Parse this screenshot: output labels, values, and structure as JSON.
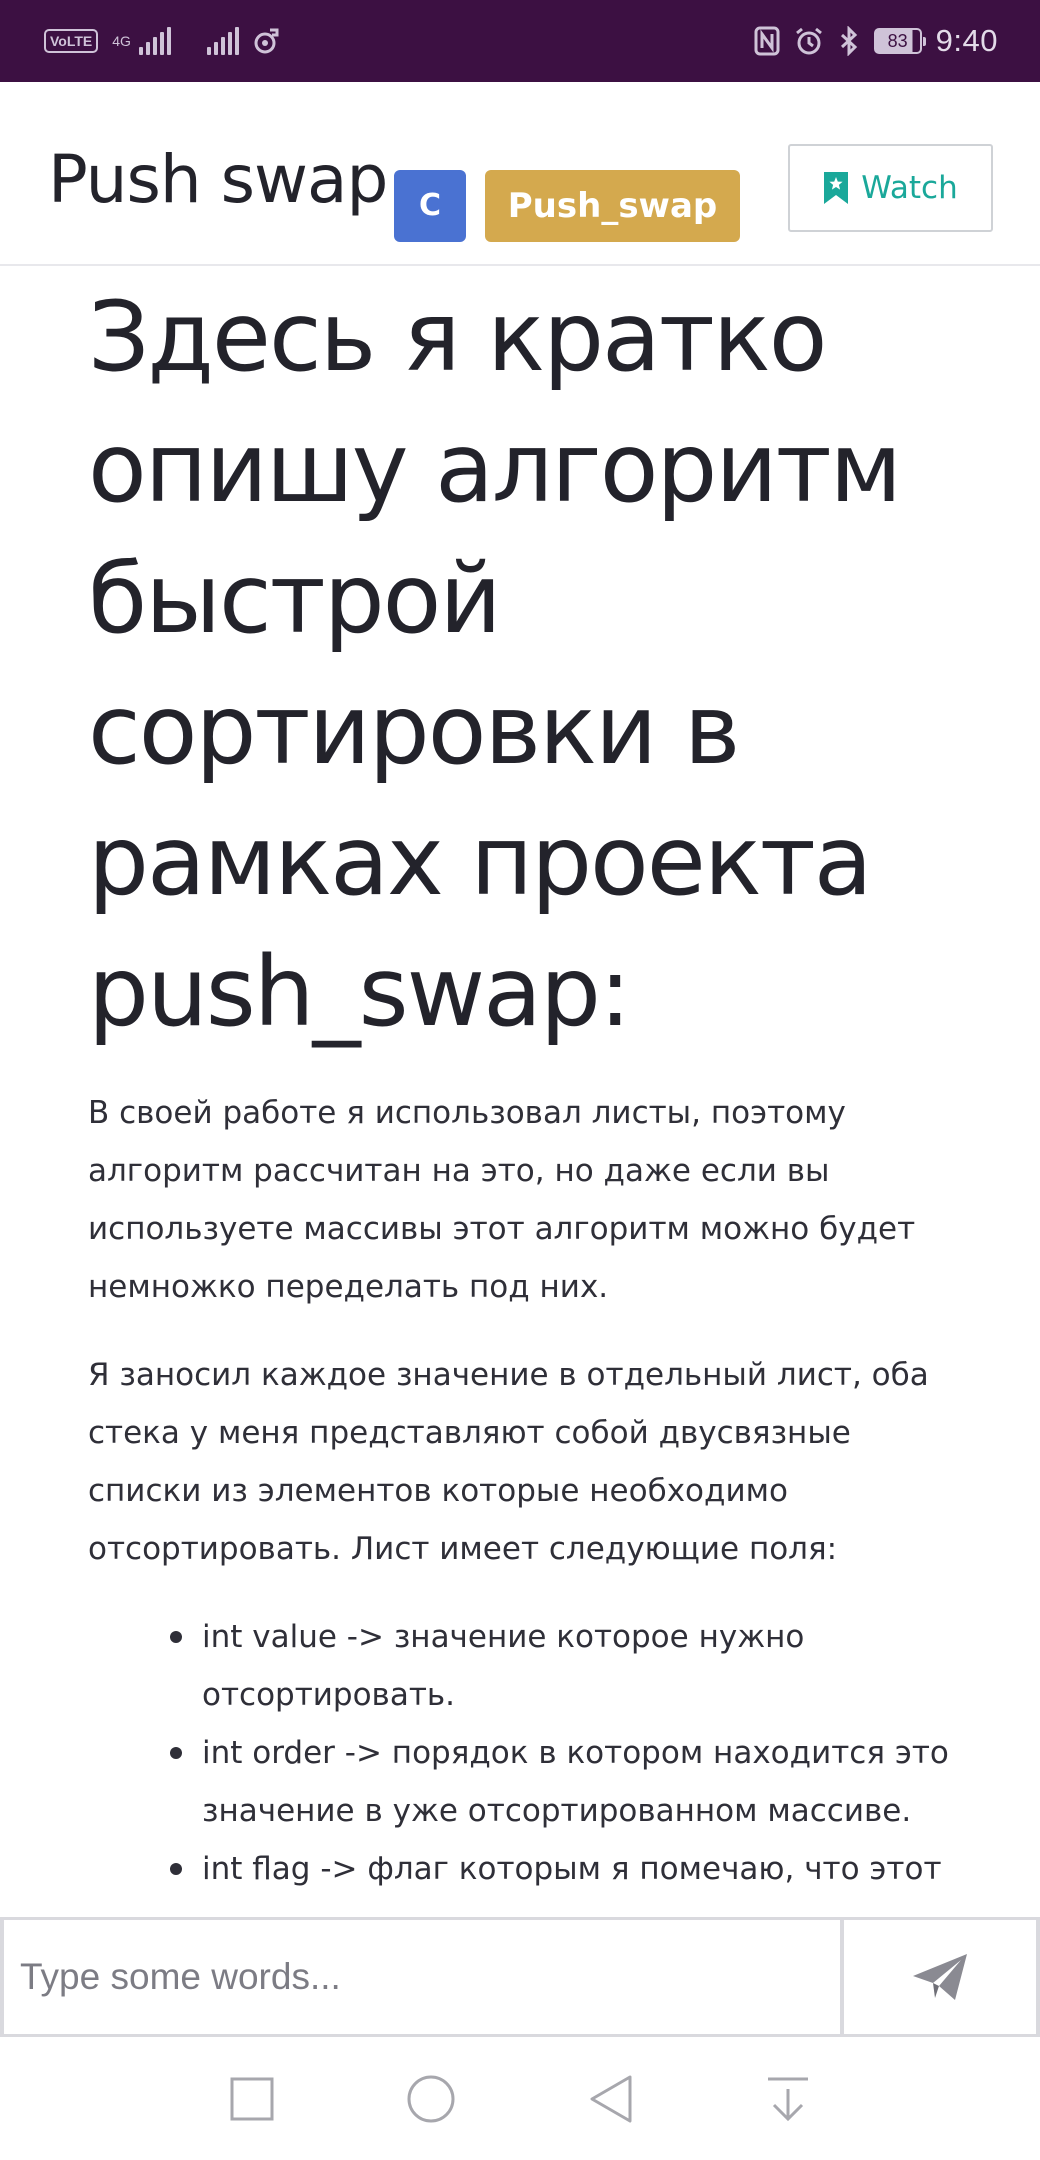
{
  "status_bar": {
    "volte": "VoLTE",
    "network": "4G",
    "battery": "83",
    "time": "9:40",
    "icons": [
      "signal-icon",
      "signal-icon",
      "music-icon",
      "nfc-icon",
      "alarm-icon",
      "bluetooth-icon",
      "battery-icon"
    ]
  },
  "header": {
    "title": "Push swap",
    "language_tag": "C",
    "project_tag": "Push_swap",
    "watch_label": "Watch",
    "accent": "#1aa89a",
    "language_color": "#4a72d2",
    "project_color": "#d4a94e"
  },
  "article": {
    "heading": "Здесь я кратко опишу алгоритм быстрой сортировки в рамках проекта push_swap:",
    "paragraphs": [
      "В своей работе я использовал листы, поэтому алгоритм рассчитан на это, но даже если вы используете массивы этот алгоритм можно будет немножко переделать под них.",
      "Я заносил каждое значение в отдельный лист, оба стека у меня представляют собой двусвязные списки из элементов которые необходимо отсортировать. Лист имеет следующие поля:"
    ],
    "bullets": [
      "int value -> значение которое нужно отсортировать.",
      "int order -> порядок в котором находится это значение в уже отсортированном массиве.",
      "int flag -> флаг которым я помечаю, что этот"
    ]
  },
  "chat_input": {
    "placeholder": "Type some words...",
    "value": "",
    "send_icon": "send-icon"
  },
  "nav_bar": {
    "icons": [
      "recent-apps-icon",
      "home-icon",
      "back-icon",
      "notifications-down-icon"
    ]
  },
  "colors": {
    "status_bar_bg": "#3c1042"
  }
}
